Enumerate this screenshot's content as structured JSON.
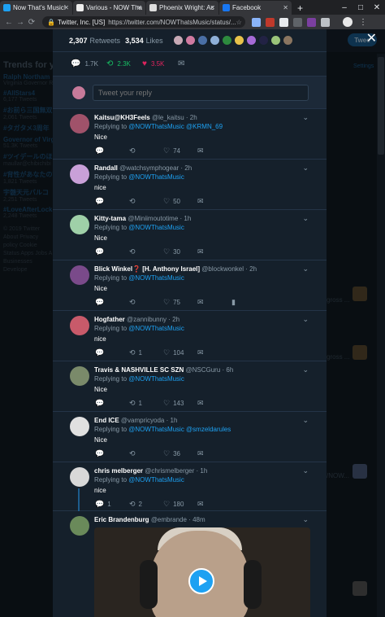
{
  "browser": {
    "tabs": [
      {
        "label": "Now That's Music!",
        "color": "#1da1f2"
      },
      {
        "label": "Various - NOW Tha",
        "color": "#333333"
      },
      {
        "label": "Phoenix Wright: Ac",
        "color": "#555555"
      },
      {
        "label": "Facebook",
        "color": "#1877f2"
      }
    ],
    "new_tab": "+",
    "window_controls": [
      "–",
      "□",
      "✕"
    ],
    "address": {
      "site": "Twitter, Inc. [US]",
      "url": "https://twitter.com/NOWThatsMusic/status/..."
    }
  },
  "background": {
    "trends_title": "Trends for yo",
    "trends": [
      {
        "name": "Ralph Northam",
        "sub": "Virginia Governor Ra"
      },
      {
        "name": "#AllStars4",
        "sub": "6,177 Tweets"
      },
      {
        "name": "#お前ら三国無双の",
        "sub": "2,061 Tweets"
      },
      {
        "name": "#タガタメ3周年",
        "sub": ""
      },
      {
        "name": "Governor of Virg",
        "sub": "51.3K Tweets"
      },
      {
        "name": "#ツイデールのほ",
        "sub": "maullar@chibichibi"
      },
      {
        "name": "#背性があなたの話",
        "sub": "1,821 Tweets"
      },
      {
        "name": "宇髄天元バルコ",
        "sub": "2,251 Tweets"
      },
      {
        "name": "#LoveAfterLocku",
        "sub": "2,248 Tweets"
      }
    ],
    "footer": "© 2019 Twitter About Privacy policy Cookie Status Apps Jobs A Businesses Develope",
    "tweet_button": "Twee",
    "settings": "Settings",
    "right_snippets": [
      "gross ...",
      "gross ...",
      "/NOW..."
    ]
  },
  "modal": {
    "close": "✕",
    "retweets_count": "2,307",
    "retweets_label": "Retweets",
    "likes_count": "3,534",
    "likes_label": "Likes",
    "likers": [
      "#c7a9b5",
      "#d07aa0",
      "#4a6fa5",
      "#8fb0d8",
      "#2d8a3e",
      "#e8c24a",
      "#a66bd6",
      "#222244",
      "#9ac47a",
      "#8a7560"
    ],
    "actions": {
      "reply": "1.7K",
      "retweet": "2.3K",
      "like": "3.5K"
    },
    "compose_placeholder": "Tweet your reply",
    "icons": {
      "reply": "💬",
      "retweet": "⟲",
      "like": "♡",
      "liked": "♥",
      "message": "✉",
      "analytics": "▮"
    },
    "replies": [
      {
        "name": "Kaitsu@KH3Feels",
        "handle": "@le_kaitsu",
        "time": "· 2h",
        "replying_label": "Replying to",
        "mentions": "@NOWThatsMusic @KRMN_69",
        "text": "Nice",
        "replies": "",
        "retweets": "",
        "likes": "74",
        "avatar": "#a0526a"
      },
      {
        "name": "Randall",
        "handle": "@watchsymphogear",
        "time": "· 2h",
        "replying_label": "Replying to",
        "mentions": "@NOWThatsMusic",
        "text": "nice",
        "replies": "",
        "retweets": "",
        "likes": "50",
        "avatar": "#c9a0d8"
      },
      {
        "name": "Kitty-tama",
        "handle": "@Miniimoutotime",
        "time": "· 1h",
        "replying_label": "Replying to",
        "mentions": "@NOWThatsMusic",
        "text": "Nice",
        "replies": "",
        "retweets": "",
        "likes": "30",
        "avatar": "#9fd0a8"
      },
      {
        "name": "Blick Winkel❓ [H. Anthony Israel]",
        "handle": "@blockwonkel",
        "time": "· 2h",
        "replying_label": "Replying to",
        "mentions": "@NOWThatsMusic",
        "text": "Nice",
        "replies": "",
        "retweets": "",
        "likes": "75",
        "avatar": "#7a4a8a"
      },
      {
        "name": "Hogfather",
        "handle": "@zannibunny",
        "time": "· 2h",
        "replying_label": "Replying to",
        "mentions": "@NOWThatsMusic",
        "text": "nice",
        "replies": "",
        "retweets": "1",
        "likes": "104",
        "avatar": "#c85a6a"
      },
      {
        "name": "Travis & NASHVILLE SC SZN",
        "handle": "@NSCGuru",
        "time": "· 6h",
        "replying_label": "Replying to",
        "mentions": "@NOWThatsMusic",
        "text": "Nice",
        "replies": "",
        "retweets": "1",
        "likes": "143",
        "avatar": "#7a8a6a"
      },
      {
        "name": "End ICE",
        "handle": "@vampricyoda",
        "time": "· 1h",
        "replying_label": "Replying to",
        "mentions": "@NOWThatsMusic @smzeldarules",
        "text": "Nice",
        "replies": "",
        "retweets": "",
        "likes": "36",
        "avatar": "#e0e0e0"
      },
      {
        "name": "chris melberger",
        "handle": "@chrismelberger",
        "time": "· 1h",
        "replying_label": "Replying to",
        "mentions": "@NOWThatsMusic",
        "text": "nice",
        "replies": "1",
        "retweets": "2",
        "likes": "180",
        "avatar": "#d8d8d8"
      },
      {
        "name": "Eric Brandenburg",
        "handle": "@embrande",
        "time": "· 48m",
        "avatar": "#6a8a5a"
      }
    ]
  }
}
